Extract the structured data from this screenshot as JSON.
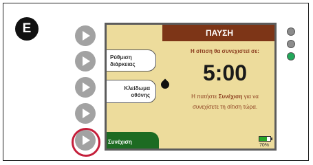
{
  "step_label": "E",
  "pump_screen": {
    "header": "ΠΑΥΣΗ",
    "soft_keys": {
      "duration_line1": "Ρύθμιση",
      "duration_line2": "διάρκειας",
      "lock_line1": "Κλείδωμα",
      "lock_line2": "οθόνης",
      "resume": "Συνέχιση"
    },
    "message": "Η σίτιση θα συνεχιστεί σε:",
    "countdown": "5:00",
    "instruction_prefix": "Η πατήστε ",
    "instruction_bold": "Συνέχιση",
    "instruction_suffix": " για να",
    "instruction_line2": "συνεχίσετε τη σίτιση τώρα.",
    "battery": {
      "percent_label": "70%",
      "level": 0.7
    }
  },
  "side_buttons": [
    {
      "highlighted": false
    },
    {
      "highlighted": false
    },
    {
      "highlighted": false
    },
    {
      "highlighted": false
    },
    {
      "highlighted": true
    }
  ],
  "leds": [
    {
      "color": "#8c8c8c"
    },
    {
      "color": "#8c8c8c"
    },
    {
      "color": "#22a85a"
    }
  ],
  "colors": {
    "header_brown": "#7d3517",
    "screen_bg": "#eddc9c",
    "resume_green": "#1d6b22",
    "highlight_red": "#c41e3a"
  }
}
